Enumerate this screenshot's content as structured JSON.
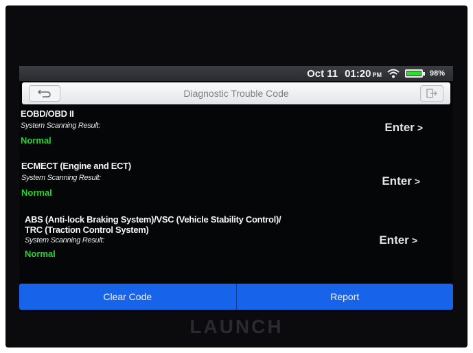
{
  "status_bar": {
    "date": "Oct 11",
    "time": "01:20",
    "meridiem": "PM",
    "battery_percent": "98%",
    "battery_level": 0.98
  },
  "title_bar": {
    "title": "Diagnostic Trouble Code",
    "back_icon": "back-arrow-icon",
    "exit_icon": "exit-icon"
  },
  "results": [
    {
      "system": "EOBD/OBD II",
      "label": "System Scanning Result:",
      "status": "Normal",
      "enter_label": "Enter"
    },
    {
      "system": "ECMECT (Engine and ECT)",
      "label": "System Scanning Result:",
      "status": "Normal",
      "enter_label": "Enter"
    },
    {
      "system_line1": "ABS (Anti-lock Braking System)/VSC (Vehicle Stability Control)/",
      "system_line2": "TRC (Traction Control System)",
      "label": "System Scanning Result:",
      "status": "Normal",
      "enter_label": "Enter"
    }
  ],
  "actions": {
    "clear_code": "Clear Code",
    "report": "Report"
  },
  "brand": "LAUNCH",
  "colors": {
    "status_ok": "#24d62e",
    "action_bar": "#1764ea"
  }
}
